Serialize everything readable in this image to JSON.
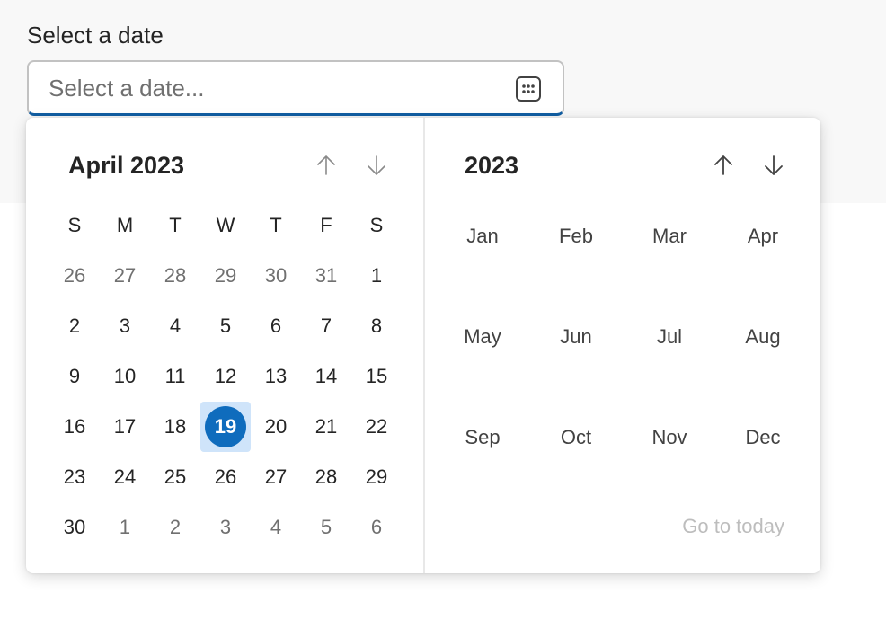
{
  "field": {
    "label": "Select a date",
    "placeholder": "Select a date...",
    "value": "",
    "calendar_icon": "calendar-icon"
  },
  "day_picker": {
    "title": "April 2023",
    "prev_icon": "arrow-up-icon",
    "next_icon": "arrow-down-icon",
    "weekdays": [
      "S",
      "M",
      "T",
      "W",
      "T",
      "F",
      "S"
    ],
    "weeks": [
      [
        "26",
        "27",
        "28",
        "29",
        "30",
        "31",
        "1"
      ],
      [
        "2",
        "3",
        "4",
        "5",
        "6",
        "7",
        "8"
      ],
      [
        "9",
        "10",
        "11",
        "12",
        "13",
        "14",
        "15"
      ],
      [
        "16",
        "17",
        "18",
        "19",
        "20",
        "21",
        "22"
      ],
      [
        "23",
        "24",
        "25",
        "26",
        "27",
        "28",
        "29"
      ],
      [
        "30",
        "1",
        "2",
        "3",
        "4",
        "5",
        "6"
      ]
    ],
    "selected_day": "19"
  },
  "month_picker": {
    "title": "2023",
    "prev_icon": "arrow-up-icon",
    "next_icon": "arrow-down-icon",
    "months": [
      "Jan",
      "Feb",
      "Mar",
      "Apr",
      "May",
      "Jun",
      "Jul",
      "Aug",
      "Sep",
      "Oct",
      "Nov",
      "Dec"
    ],
    "go_to_today": "Go to today"
  },
  "colors": {
    "accent": "#0f6cbd",
    "selected_bg": "#cfe4fa",
    "input_underline": "#115ea3"
  }
}
